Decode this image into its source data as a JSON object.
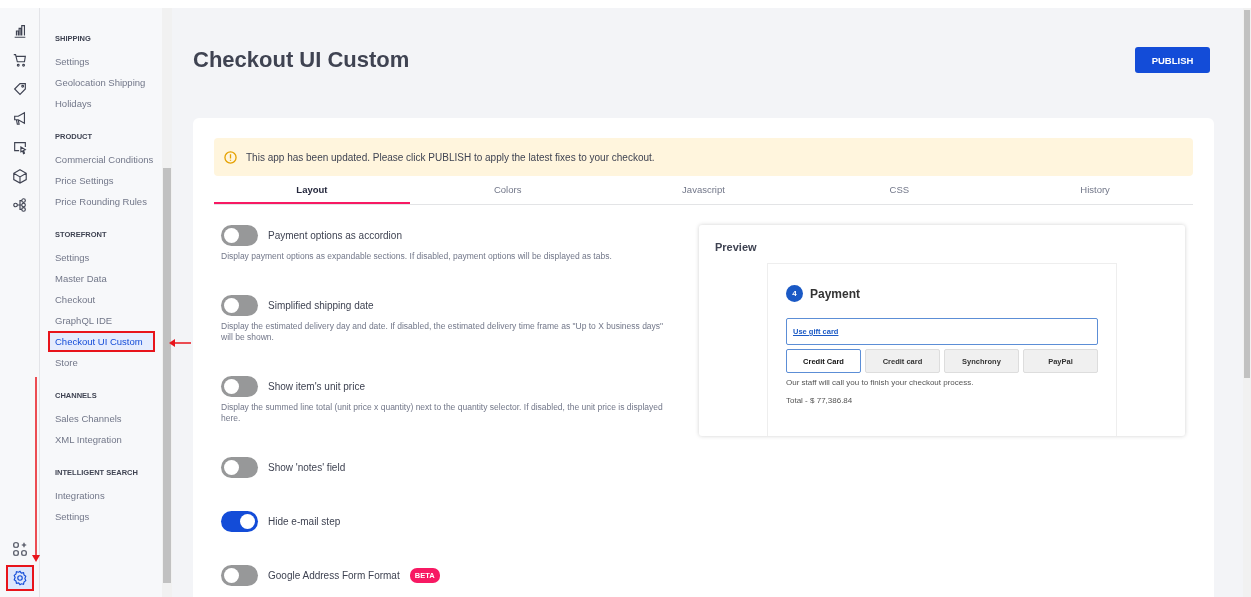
{
  "rail": {
    "top_icons": [
      {
        "kind": "chart",
        "selected": false
      },
      {
        "kind": "cart",
        "selected": false
      },
      {
        "kind": "tag",
        "selected": false
      },
      {
        "kind": "megaphone",
        "selected": false
      },
      {
        "kind": "screen",
        "selected": false
      },
      {
        "kind": "box",
        "selected": false
      },
      {
        "kind": "flow",
        "selected": false
      }
    ],
    "bottom_icons": [
      {
        "kind": "apps",
        "selected": false
      },
      {
        "kind": "gear",
        "selected": true
      }
    ]
  },
  "sidebar": {
    "sections": [
      {
        "title": "SHIPPING",
        "items": [
          {
            "label": "Settings",
            "selected": false
          },
          {
            "label": "Geolocation Shipping",
            "selected": false
          },
          {
            "label": "Holidays",
            "selected": false
          }
        ]
      },
      {
        "title": "PRODUCT",
        "items": [
          {
            "label": "Commercial Conditions",
            "selected": false
          },
          {
            "label": "Price Settings",
            "selected": false
          },
          {
            "label": "Price Rounding Rules",
            "selected": false
          }
        ]
      },
      {
        "title": "STOREFRONT",
        "items": [
          {
            "label": "Settings",
            "selected": false
          },
          {
            "label": "Master Data",
            "selected": false
          },
          {
            "label": "Checkout",
            "selected": false
          },
          {
            "label": "GraphQL IDE",
            "selected": false
          },
          {
            "label": "Checkout UI Custom",
            "selected": true
          },
          {
            "label": "Store",
            "selected": false
          }
        ]
      },
      {
        "title": "CHANNELS",
        "items": [
          {
            "label": "Sales Channels",
            "selected": false
          },
          {
            "label": "XML Integration",
            "selected": false
          }
        ]
      },
      {
        "title": "INTELLIGENT SEARCH",
        "items": [
          {
            "label": "Integrations",
            "selected": false
          },
          {
            "label": "Settings",
            "selected": false
          }
        ]
      }
    ]
  },
  "page": {
    "title": "Checkout UI Custom",
    "publish_button": "PUBLISH"
  },
  "alert": {
    "text": "This app has been updated. Please click PUBLISH to apply the latest fixes to your checkout."
  },
  "tabs": [
    {
      "label": "Layout",
      "selected": true
    },
    {
      "label": "Colors",
      "selected": false
    },
    {
      "label": "Javascript",
      "selected": false
    },
    {
      "label": "CSS",
      "selected": false
    },
    {
      "label": "History",
      "selected": false
    }
  ],
  "settings": [
    {
      "label": "Payment options as accordion",
      "on": false,
      "description": "Display payment options as expandable sections. If disabled, payment options will be displayed as tabs."
    },
    {
      "label": "Simplified shipping date",
      "on": false,
      "description": "Display the estimated delivery day and date. If disabled, the estimated delivery time frame as \"Up to X business days\" will be shown."
    },
    {
      "label": "Show item's unit price",
      "on": false,
      "description": "Display the summed line total (unit price x quantity) next to the quantity selector. If disabled, the unit price is displayed here."
    },
    {
      "label": "Show 'notes' field",
      "on": false
    },
    {
      "label": "Hide e-mail step",
      "on": true
    },
    {
      "label": "Google Address Form Format",
      "on": false,
      "badge": "BETA"
    }
  ],
  "preview": {
    "title": "Preview",
    "step_number": "4",
    "heading": "Payment",
    "gift_card_link": "Use gift card",
    "payment_tabs": [
      {
        "label": "Credit Card",
        "selected": true
      },
      {
        "label": "Credit card",
        "selected": false
      },
      {
        "label": "Synchrony",
        "selected": false
      },
      {
        "label": "PayPal",
        "selected": false
      }
    ],
    "message": "Our staff will call you to finish your checkout process.",
    "total": "Total - $ 77,386.84"
  }
}
